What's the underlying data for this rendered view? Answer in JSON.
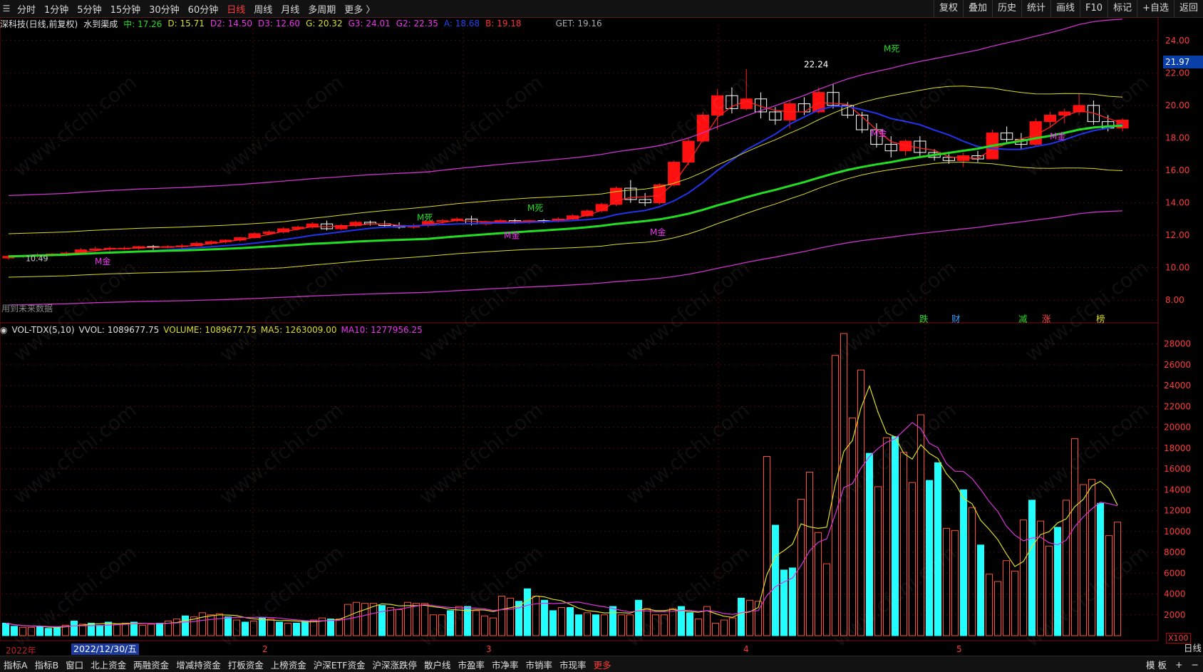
{
  "topbar": {
    "tabs": [
      "分时",
      "1分钟",
      "5分钟",
      "15分钟",
      "30分钟",
      "60分钟",
      "日线",
      "周线",
      "月线",
      "多周期",
      "更多 〉"
    ],
    "active_tab": "日线",
    "right_buttons": [
      "复权",
      "叠加",
      "历史",
      "统计",
      "画线",
      "F10",
      "标记",
      "+自选",
      "返回"
    ]
  },
  "info": {
    "stock": "深科技(日线,前复权)",
    "indicator": "水到渠成",
    "zhong": "中: 17.26",
    "d": "D: 15.71",
    "d2": "D2: 14.50",
    "d3": "D3: 12.60",
    "g": "G: 20.32",
    "g3": "G3: 24.01",
    "g2": "G2: 22.35",
    "a": "A: 18.68",
    "b": "B: 19.18",
    "get": "GET: 19.16"
  },
  "volinfo": {
    "name": "VOL-TDX(5,10)",
    "vvol": "VVOL: 1089677.75",
    "volume": "VOLUME: 1089677.75",
    "ma5": "MA5: 1263009.00",
    "ma10": "MA10: 1277956.25"
  },
  "price_axis": [
    "24.00",
    "22.00",
    "20.00",
    "18.00",
    "16.00",
    "14.00",
    "12.00",
    "10.00",
    "8.00"
  ],
  "price_tag": "21.97",
  "vol_axis": [
    "28000",
    "26000",
    "24000",
    "22000",
    "20000",
    "18000",
    "16000",
    "14000",
    "12000",
    "10000",
    "8000",
    "6000",
    "4000",
    "2000"
  ],
  "x100": "X100",
  "day_label": "日线",
  "date_box": "2022/12/30/五",
  "year_label": "2022年",
  "months": [
    "2",
    "3",
    "4",
    "5"
  ],
  "annotations": {
    "high": "22.24",
    "low": "10.49",
    "future": "用到未来数据",
    "mdeath": "M死",
    "mgold": "M金",
    "sig1": "跌",
    "sig2": "财",
    "sig3": "减",
    "sig4": "涨",
    "sig5": "榜"
  },
  "bottombar": {
    "items": [
      "指标A",
      "指标B",
      "窗口",
      "北上资金",
      "两融资金",
      "增减持资金",
      "打板资金",
      "上榜资金",
      "沪深ETF资金",
      "沪深涨跌停",
      "散户线",
      "市盈率",
      "市净率",
      "市销率",
      "市现率",
      "更多"
    ],
    "right": [
      "模 板",
      "+",
      "−"
    ]
  },
  "watermark": "www.cfchi.com",
  "colors": {
    "up": "#ff2020",
    "down": "#00ffff",
    "accent": "#ff3b3b",
    "ma_green": "#22dd22",
    "ma_blue": "#2233ee",
    "magenta": "#cc33cc",
    "yellow": "#dddd22"
  },
  "chart_data": {
    "type": "candlestick",
    "ylim": [
      7,
      25
    ],
    "candles": [
      [
        10.6,
        10.8,
        10.5,
        10.7
      ],
      [
        10.7,
        10.8,
        10.6,
        10.75
      ],
      [
        10.75,
        10.9,
        10.6,
        10.8
      ],
      [
        10.8,
        10.9,
        10.7,
        10.85
      ],
      [
        10.85,
        11.0,
        10.7,
        10.9
      ],
      [
        10.9,
        11.2,
        10.8,
        11.1
      ],
      [
        11.1,
        11.3,
        11.0,
        11.15
      ],
      [
        11.15,
        11.3,
        11.0,
        11.2
      ],
      [
        11.2,
        11.3,
        11.1,
        11.2
      ],
      [
        11.2,
        11.35,
        11.1,
        11.3
      ],
      [
        11.3,
        11.4,
        11.1,
        11.25
      ],
      [
        11.25,
        11.4,
        11.2,
        11.3
      ],
      [
        11.3,
        11.45,
        11.2,
        11.35
      ],
      [
        11.35,
        11.6,
        11.3,
        11.5
      ],
      [
        11.5,
        11.7,
        11.4,
        11.6
      ],
      [
        11.6,
        11.75,
        11.5,
        11.7
      ],
      [
        11.7,
        11.9,
        11.6,
        11.85
      ],
      [
        11.85,
        12.2,
        11.8,
        12.1
      ],
      [
        12.1,
        12.3,
        12.0,
        12.2
      ],
      [
        12.2,
        12.5,
        12.1,
        12.4
      ],
      [
        12.4,
        12.6,
        12.3,
        12.5
      ],
      [
        12.5,
        12.8,
        12.4,
        12.7
      ],
      [
        12.7,
        12.9,
        12.3,
        12.4
      ],
      [
        12.4,
        12.7,
        12.3,
        12.6
      ],
      [
        12.6,
        12.9,
        12.5,
        12.8
      ],
      [
        12.8,
        12.9,
        12.6,
        12.7
      ],
      [
        12.7,
        12.9,
        12.5,
        12.6
      ],
      [
        12.6,
        12.8,
        12.4,
        12.5
      ],
      [
        12.5,
        12.7,
        12.4,
        12.6
      ],
      [
        12.6,
        12.9,
        12.5,
        12.85
      ],
      [
        12.85,
        13.0,
        12.7,
        12.9
      ],
      [
        12.9,
        13.1,
        12.8,
        13.0
      ],
      [
        13.0,
        13.2,
        12.6,
        12.7
      ],
      [
        12.7,
        12.9,
        12.6,
        12.8
      ],
      [
        12.8,
        13.0,
        12.7,
        12.9
      ],
      [
        12.9,
        13.0,
        12.7,
        12.8
      ],
      [
        12.8,
        12.95,
        12.7,
        12.9
      ],
      [
        12.9,
        13.0,
        12.75,
        12.85
      ],
      [
        12.85,
        13.1,
        12.8,
        13.0
      ],
      [
        13.0,
        13.3,
        12.9,
        13.2
      ],
      [
        13.2,
        13.6,
        13.1,
        13.5
      ],
      [
        13.5,
        14.0,
        13.4,
        13.9
      ],
      [
        13.9,
        15.0,
        13.8,
        14.9
      ],
      [
        14.9,
        15.4,
        14.0,
        14.2
      ],
      [
        14.2,
        14.6,
        13.8,
        14.0
      ],
      [
        14.0,
        15.2,
        13.9,
        15.1
      ],
      [
        15.1,
        16.6,
        15.0,
        16.5
      ],
      [
        16.5,
        18.0,
        16.3,
        17.8
      ],
      [
        17.8,
        19.6,
        17.7,
        19.4
      ],
      [
        19.4,
        21.0,
        18.5,
        20.6
      ],
      [
        20.6,
        21.1,
        19.5,
        19.8
      ],
      [
        19.8,
        22.24,
        19.7,
        20.4
      ],
      [
        20.4,
        20.8,
        19.2,
        19.6
      ],
      [
        19.6,
        19.9,
        18.8,
        19.1
      ],
      [
        19.1,
        20.3,
        18.6,
        20.1
      ],
      [
        20.1,
        20.5,
        19.4,
        19.6
      ],
      [
        19.6,
        21.1,
        19.5,
        20.8
      ],
      [
        20.8,
        21.3,
        19.8,
        20.0
      ],
      [
        20.0,
        20.2,
        19.2,
        19.4
      ],
      [
        19.4,
        19.6,
        18.3,
        18.5
      ],
      [
        18.5,
        18.9,
        17.4,
        17.6
      ],
      [
        17.6,
        18.1,
        16.8,
        17.2
      ],
      [
        17.2,
        17.9,
        16.9,
        17.8
      ],
      [
        17.8,
        18.1,
        16.8,
        17.1
      ],
      [
        17.1,
        17.3,
        16.6,
        16.8
      ],
      [
        16.8,
        17.0,
        16.4,
        16.6
      ],
      [
        16.6,
        17.1,
        16.2,
        16.9
      ],
      [
        16.9,
        17.2,
        16.5,
        16.7
      ],
      [
        16.7,
        18.5,
        16.7,
        18.3
      ],
      [
        18.3,
        18.7,
        17.6,
        17.9
      ],
      [
        17.9,
        18.3,
        17.3,
        17.6
      ],
      [
        17.6,
        19.2,
        17.5,
        19.0
      ],
      [
        19.0,
        19.6,
        18.7,
        19.4
      ],
      [
        19.4,
        19.8,
        18.9,
        19.6
      ],
      [
        19.6,
        20.7,
        19.4,
        20.0
      ],
      [
        20.0,
        20.3,
        18.8,
        19.0
      ],
      [
        19.0,
        19.4,
        18.4,
        18.6
      ],
      [
        18.6,
        19.2,
        18.4,
        19.1
      ]
    ],
    "volume": [
      12,
      9,
      8,
      8,
      9,
      7,
      8,
      10,
      14,
      11,
      12,
      10,
      13,
      11,
      12,
      13,
      10,
      11,
      12,
      14,
      16,
      19,
      18,
      22,
      20,
      21,
      18,
      15,
      13,
      14,
      17,
      16,
      13,
      12,
      12,
      14,
      15,
      17,
      16,
      16,
      30,
      32,
      31,
      31,
      29,
      27,
      25,
      32,
      31,
      31,
      20,
      20,
      24,
      28,
      28,
      24,
      19,
      17,
      38,
      36,
      33,
      45,
      38,
      34,
      24,
      27,
      27,
      20,
      22,
      20,
      20,
      28,
      20,
      20,
      34,
      26,
      20,
      20,
      26,
      28,
      22,
      16,
      28,
      12,
      15,
      17,
      36,
      34,
      33,
      172,
      106,
      63,
      65,
      131,
      157,
      99,
      69,
      269,
      290,
      209,
      255,
      175,
      143,
      190,
      191,
      176,
      147,
      212,
      149,
      166,
      103,
      101,
      140,
      123,
      87,
      59,
      52,
      72,
      62,
      111,
      130,
      110,
      86,
      104,
      130,
      189,
      145,
      150,
      127,
      96,
      109
    ],
    "volume_up": [
      0,
      0,
      1,
      1,
      0,
      0,
      0,
      1,
      0,
      1,
      0,
      0,
      0,
      1,
      1,
      0,
      1,
      1,
      0,
      1,
      1,
      0,
      1,
      1,
      1,
      1,
      0,
      1,
      0,
      1,
      0,
      1,
      0,
      1,
      0,
      0,
      1,
      1,
      0,
      1,
      1,
      1,
      1,
      1,
      0,
      1,
      1,
      1,
      1,
      1,
      1,
      1,
      0,
      1,
      0,
      1,
      1,
      1,
      1,
      1,
      0,
      0,
      1,
      0,
      0,
      1,
      0,
      0,
      1,
      0,
      1,
      0,
      1,
      1,
      0,
      1,
      1,
      1,
      1,
      0,
      0,
      1,
      1,
      1,
      1,
      1,
      0,
      1,
      1,
      1,
      0,
      0,
      0,
      1,
      1,
      1,
      1,
      1,
      1,
      1,
      1,
      0,
      1,
      1,
      0,
      1,
      1,
      1,
      0,
      0,
      1,
      1,
      0,
      1,
      0,
      1,
      1,
      1,
      1,
      1,
      0,
      1,
      1,
      0,
      1,
      1,
      1,
      1,
      0,
      1,
      1,
      0,
      0
    ],
    "vol_ylim": [
      0,
      29000
    ]
  }
}
